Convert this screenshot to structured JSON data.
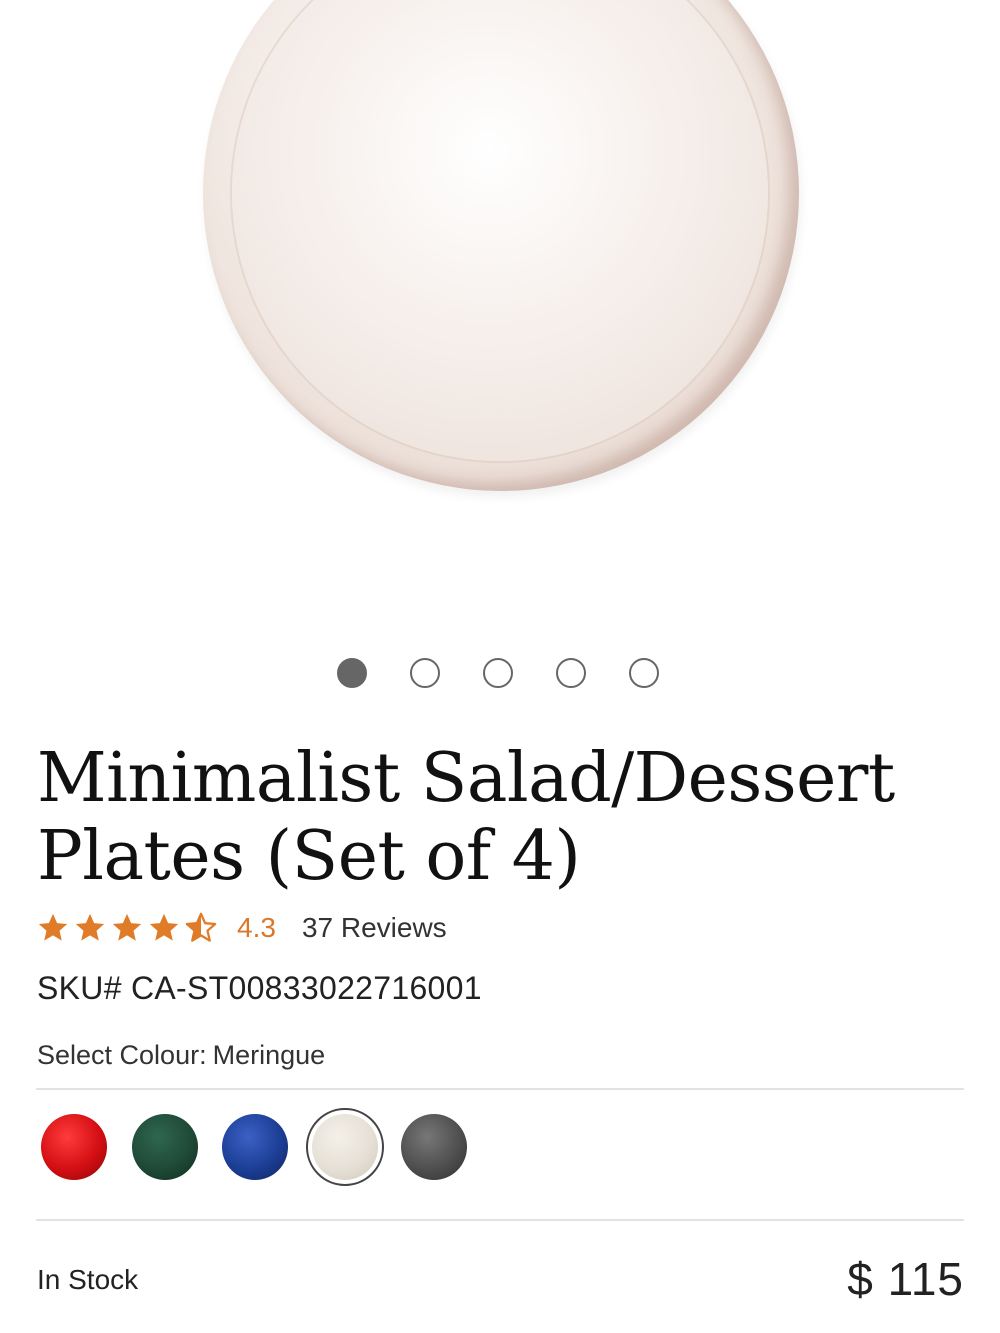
{
  "gallery": {
    "slides": [
      {
        "state": "active"
      },
      {
        "state": "inactive"
      },
      {
        "state": "inactive"
      },
      {
        "state": "inactive"
      },
      {
        "state": "inactive"
      }
    ]
  },
  "product": {
    "title_line1": "Minimalist Salad/Dessert",
    "title_line2": "Plates (Set of 4)",
    "rating": "4.3",
    "rating_numeric": 4.3,
    "stars_max": 5,
    "reviews": "37 Reviews",
    "sku": "SKU# CA-ST00833022716001"
  },
  "colour": {
    "label": "Select Colour:",
    "selected": "Meringue",
    "swatches": [
      {
        "name": "red",
        "color": "#d30f14"
      },
      {
        "name": "green",
        "color": "#1f4a37"
      },
      {
        "name": "blue",
        "color": "#1c3e96"
      },
      {
        "name": "Meringue",
        "color": "#e6e0d6",
        "selected": true
      },
      {
        "name": "grey",
        "color": "#4f4f4f"
      }
    ]
  },
  "availability": {
    "stock": "In Stock",
    "price": "$ 115"
  },
  "colors": {
    "accent_star": "#e07b27"
  }
}
